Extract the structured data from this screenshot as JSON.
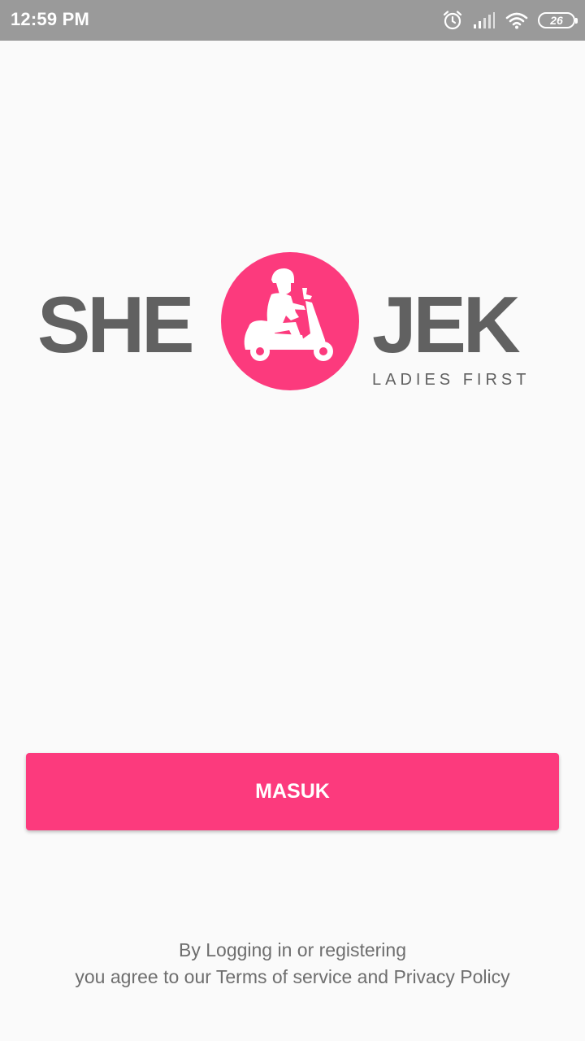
{
  "status_bar": {
    "time": "12:59 PM",
    "battery_level": "26",
    "icons": [
      "alarm-icon",
      "signal-icon",
      "wifi-icon",
      "battery-icon"
    ]
  },
  "logo": {
    "left_word": "SHE",
    "right_word": "JEK",
    "tagline": "LADIES FIRST",
    "accent_color": "#fc3a7d",
    "text_color": "#616161",
    "icon": "scooter-rider-icon"
  },
  "login_button": {
    "label": "MASUK",
    "color": "#fc3a7d"
  },
  "terms": {
    "line1": "By Logging in or registering",
    "line2": "you agree to our Terms of service and Privacy Policy"
  }
}
